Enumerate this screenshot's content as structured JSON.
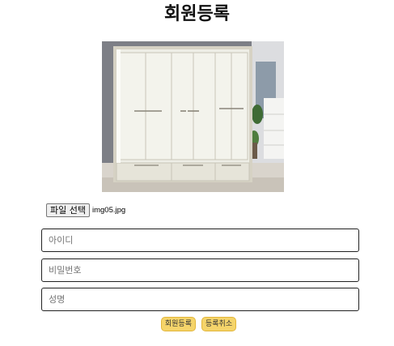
{
  "header": {
    "title": "회원등록"
  },
  "photo": {
    "alt": "wardrobe-image"
  },
  "file": {
    "button_label": "파일 선택",
    "file_name": "img05.jpg"
  },
  "form": {
    "id_placeholder": "아이디",
    "password_placeholder": "비밀번호",
    "name_placeholder": "성명"
  },
  "actions": {
    "register_label": "회원등록",
    "cancel_label": "등록취소"
  },
  "colors": {
    "button_bg": "#f5d46a",
    "button_border": "#e2b63b"
  }
}
